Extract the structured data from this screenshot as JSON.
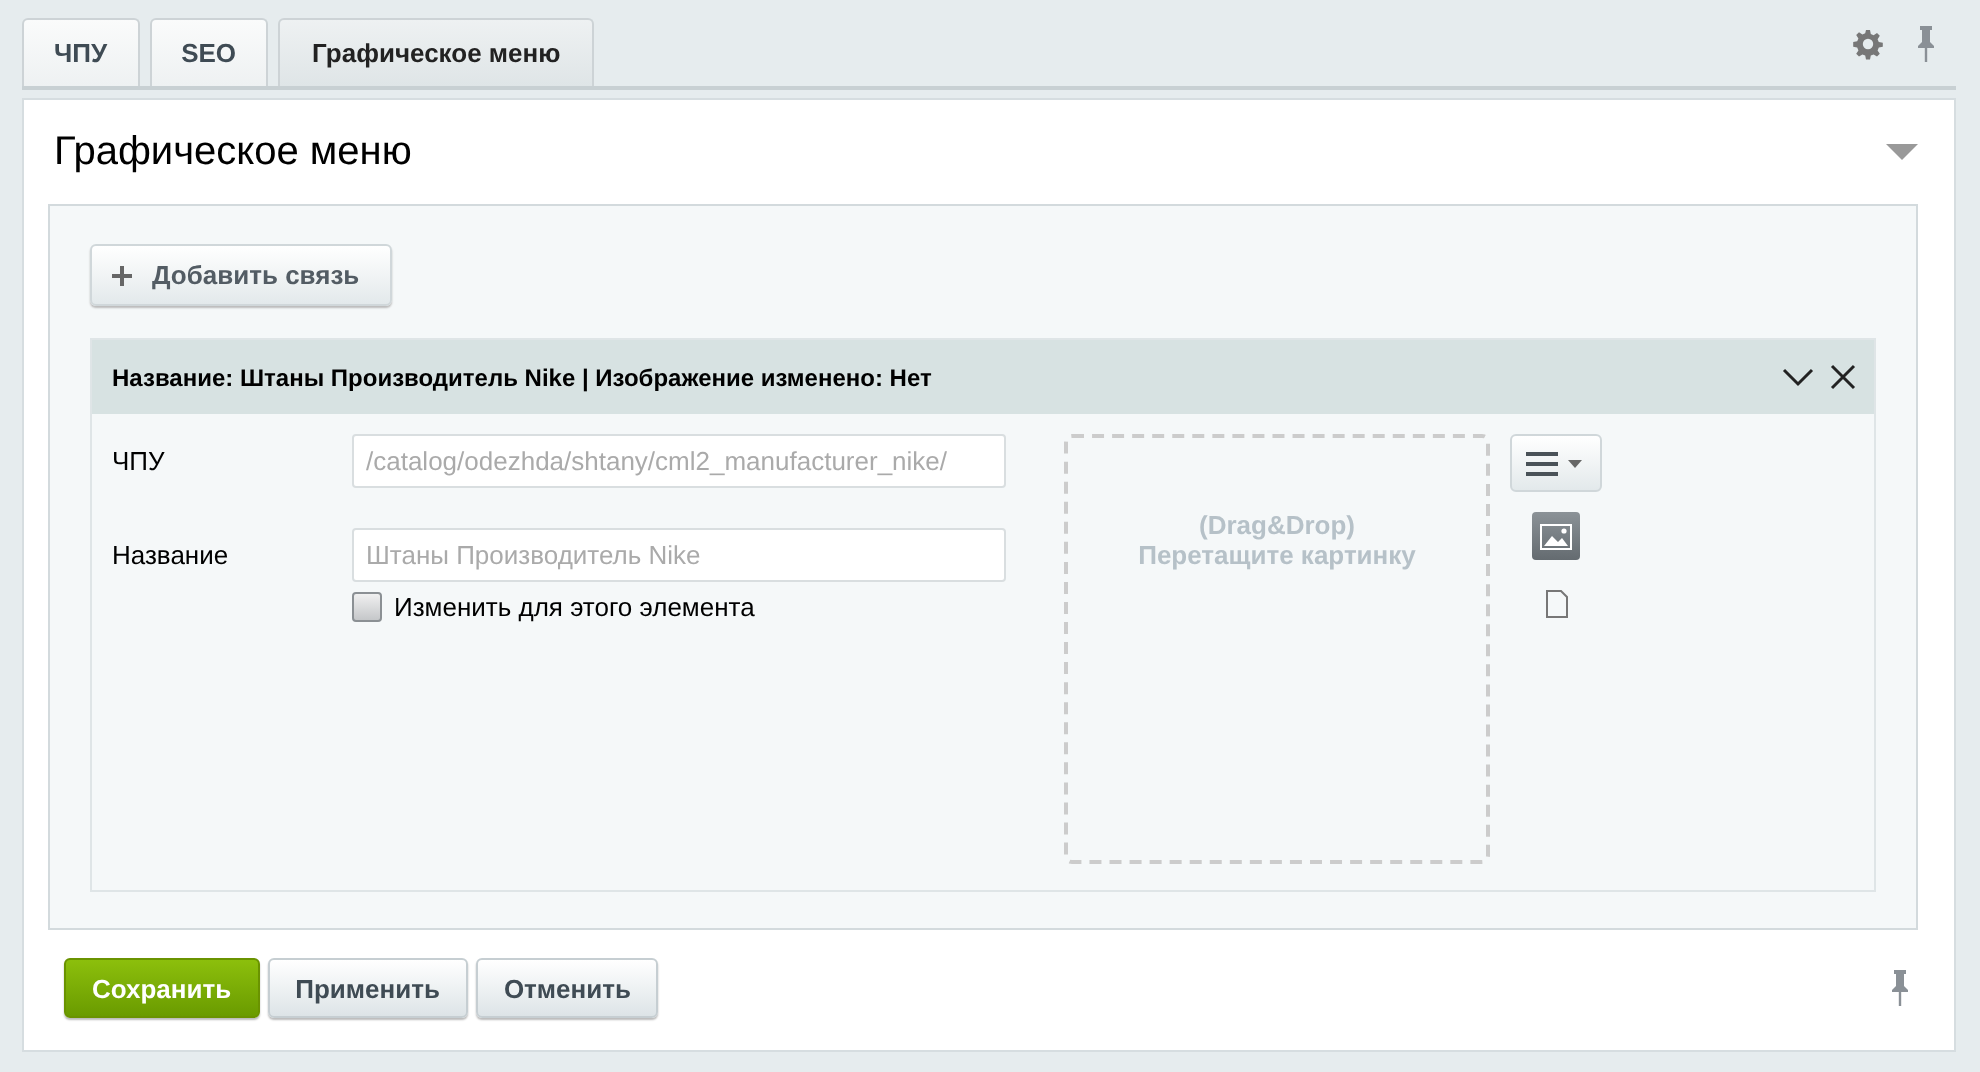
{
  "tabs": [
    {
      "label": "ЧПУ",
      "selected": false
    },
    {
      "label": "SEO",
      "selected": false
    },
    {
      "label": "Графическое меню",
      "selected": true
    }
  ],
  "section": {
    "title": "Графическое меню",
    "expanded": true
  },
  "add_button": {
    "label": "Добавить связь"
  },
  "item": {
    "header": "Название: Штаны Производитель Nike | Изображение изменено: Нет",
    "fields": [
      {
        "label": "ЧПУ",
        "placeholder": "/catalog/odezhda/shtany/cml2_manufacturer_nike/"
      },
      {
        "label": "Название",
        "placeholder": "Штаны Производитель Nike"
      }
    ],
    "checkbox": {
      "label": "Изменить для этого элемента",
      "checked": false
    },
    "dropzone": {
      "line_1": "(Drag&Drop)",
      "line_2": "Перетащите картинку"
    },
    "view_modes": [
      {
        "kind": "image",
        "selected": true
      },
      {
        "kind": "file",
        "selected": false
      }
    ]
  },
  "buttons": [
    {
      "label": "Сохранить",
      "kind": "primary"
    },
    {
      "label": "Применить",
      "kind": "normal"
    },
    {
      "label": "Отменить",
      "kind": "normal"
    }
  ]
}
